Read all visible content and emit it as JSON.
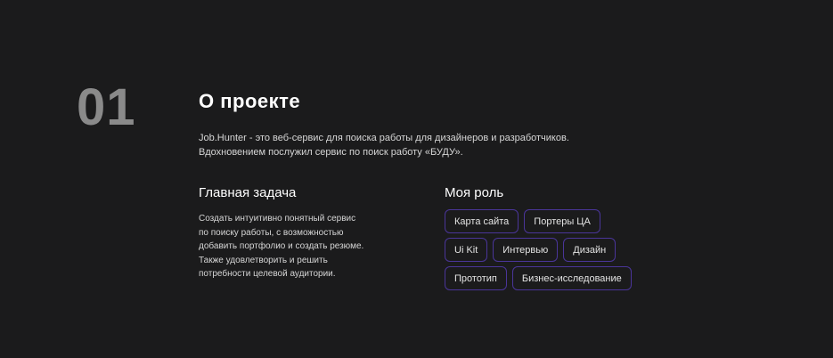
{
  "section": {
    "number": "01",
    "title": "О проекте"
  },
  "intro": {
    "lines": [
      "Job.Hunter - это веб-сервис для поиска работы для дизайнеров и разработчиков.",
      "Вдохновением послужил сервис по поиск работу «БУДУ»."
    ]
  },
  "task": {
    "title": "Главная задача",
    "lines": [
      "Создать интуитивно понятный сервис",
      "по поиску работы, с возможностью",
      "добавить портфолио и создать резюме.",
      "Также удовлетворить и решить",
      "потребности целевой аудитории."
    ]
  },
  "role": {
    "title": "Моя роль",
    "tags": [
      "Карта сайта",
      "Портеры ЦА",
      "Ui Kit",
      "Интервью",
      "Дизайн",
      "Прототип",
      "Бизнес-исследование"
    ]
  },
  "colors": {
    "background": "#1b1b1c",
    "number": "#8a8a8a",
    "tag_border": "#4a3599"
  }
}
